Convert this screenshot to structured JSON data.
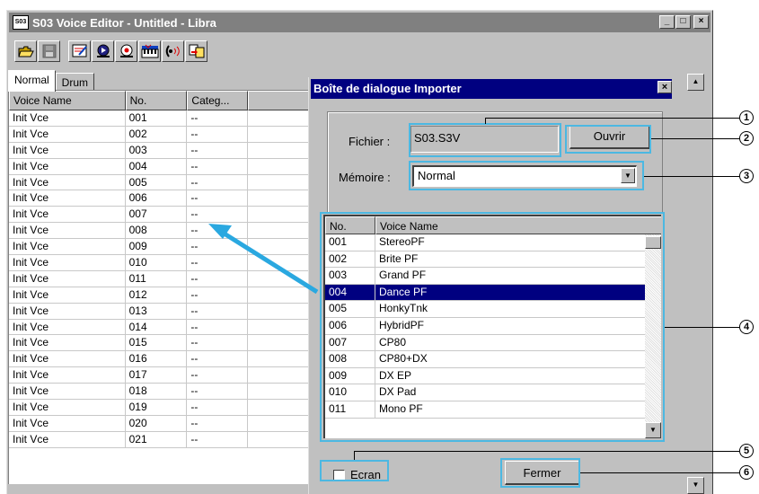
{
  "window": {
    "title": "S03 Voice Editor - Untitled - Libra",
    "app_icon_text": "S03",
    "controls": [
      "_",
      "□",
      "×"
    ]
  },
  "toolbar": {
    "tools": [
      "open-folder-icon",
      "save-disk-icon",
      "edit-voice-icon",
      "play-icon",
      "settings-icon",
      "keyboard-icon",
      "audition-icon",
      "import-export-icon"
    ]
  },
  "left_panel": {
    "tabs": [
      "Normal",
      "Drum"
    ],
    "columns": [
      "Voice Name",
      "No.",
      "Categ..."
    ],
    "rows": [
      [
        "Init Vce",
        "001",
        "--"
      ],
      [
        "Init Vce",
        "002",
        "--"
      ],
      [
        "Init Vce",
        "003",
        "--"
      ],
      [
        "Init Vce",
        "004",
        "--"
      ],
      [
        "Init Vce",
        "005",
        "--"
      ],
      [
        "Init Vce",
        "006",
        "--"
      ],
      [
        "Init Vce",
        "007",
        "--"
      ],
      [
        "Init Vce",
        "008",
        "--"
      ],
      [
        "Init Vce",
        "009",
        "--"
      ],
      [
        "Init Vce",
        "010",
        "--"
      ],
      [
        "Init Vce",
        "011",
        "--"
      ],
      [
        "Init Vce",
        "012",
        "--"
      ],
      [
        "Init Vce",
        "013",
        "--"
      ],
      [
        "Init Vce",
        "014",
        "--"
      ],
      [
        "Init Vce",
        "015",
        "--"
      ],
      [
        "Init Vce",
        "016",
        "--"
      ],
      [
        "Init Vce",
        "017",
        "--"
      ],
      [
        "Init Vce",
        "018",
        "--"
      ],
      [
        "Init Vce",
        "019",
        "--"
      ],
      [
        "Init Vce",
        "020",
        "--"
      ],
      [
        "Init Vce",
        "021",
        "--"
      ]
    ]
  },
  "dialog": {
    "title": "Boîte de dialogue Importer",
    "close": "×",
    "file_label": "Fichier :",
    "file_value": "S03.S3V",
    "open_button": "Ouvrir",
    "memory_label": "Mémoire :",
    "memory_value": "Normal",
    "list_columns": [
      "No.",
      "Voice Name"
    ],
    "list_rows": [
      [
        "001",
        "StereoPF"
      ],
      [
        "002",
        "Brite PF"
      ],
      [
        "003",
        "Grand PF"
      ],
      [
        "004",
        "Dance PF"
      ],
      [
        "005",
        "HonkyTnk"
      ],
      [
        "006",
        "HybridPF"
      ],
      [
        "007",
        "CP80"
      ],
      [
        "008",
        "CP80+DX"
      ],
      [
        "009",
        "DX EP"
      ],
      [
        "010",
        "DX Pad"
      ],
      [
        "011",
        "Mono PF"
      ]
    ],
    "selected_index": 3,
    "screen_checkbox_label": "Ecran",
    "screen_checked": false,
    "close_button": "Fermer"
  },
  "callouts": [
    "1",
    "2",
    "3",
    "4",
    "5",
    "6"
  ],
  "colors": {
    "highlight": "#4cb8e2",
    "selection": "#000080",
    "arrow": "#2aa8e0"
  }
}
